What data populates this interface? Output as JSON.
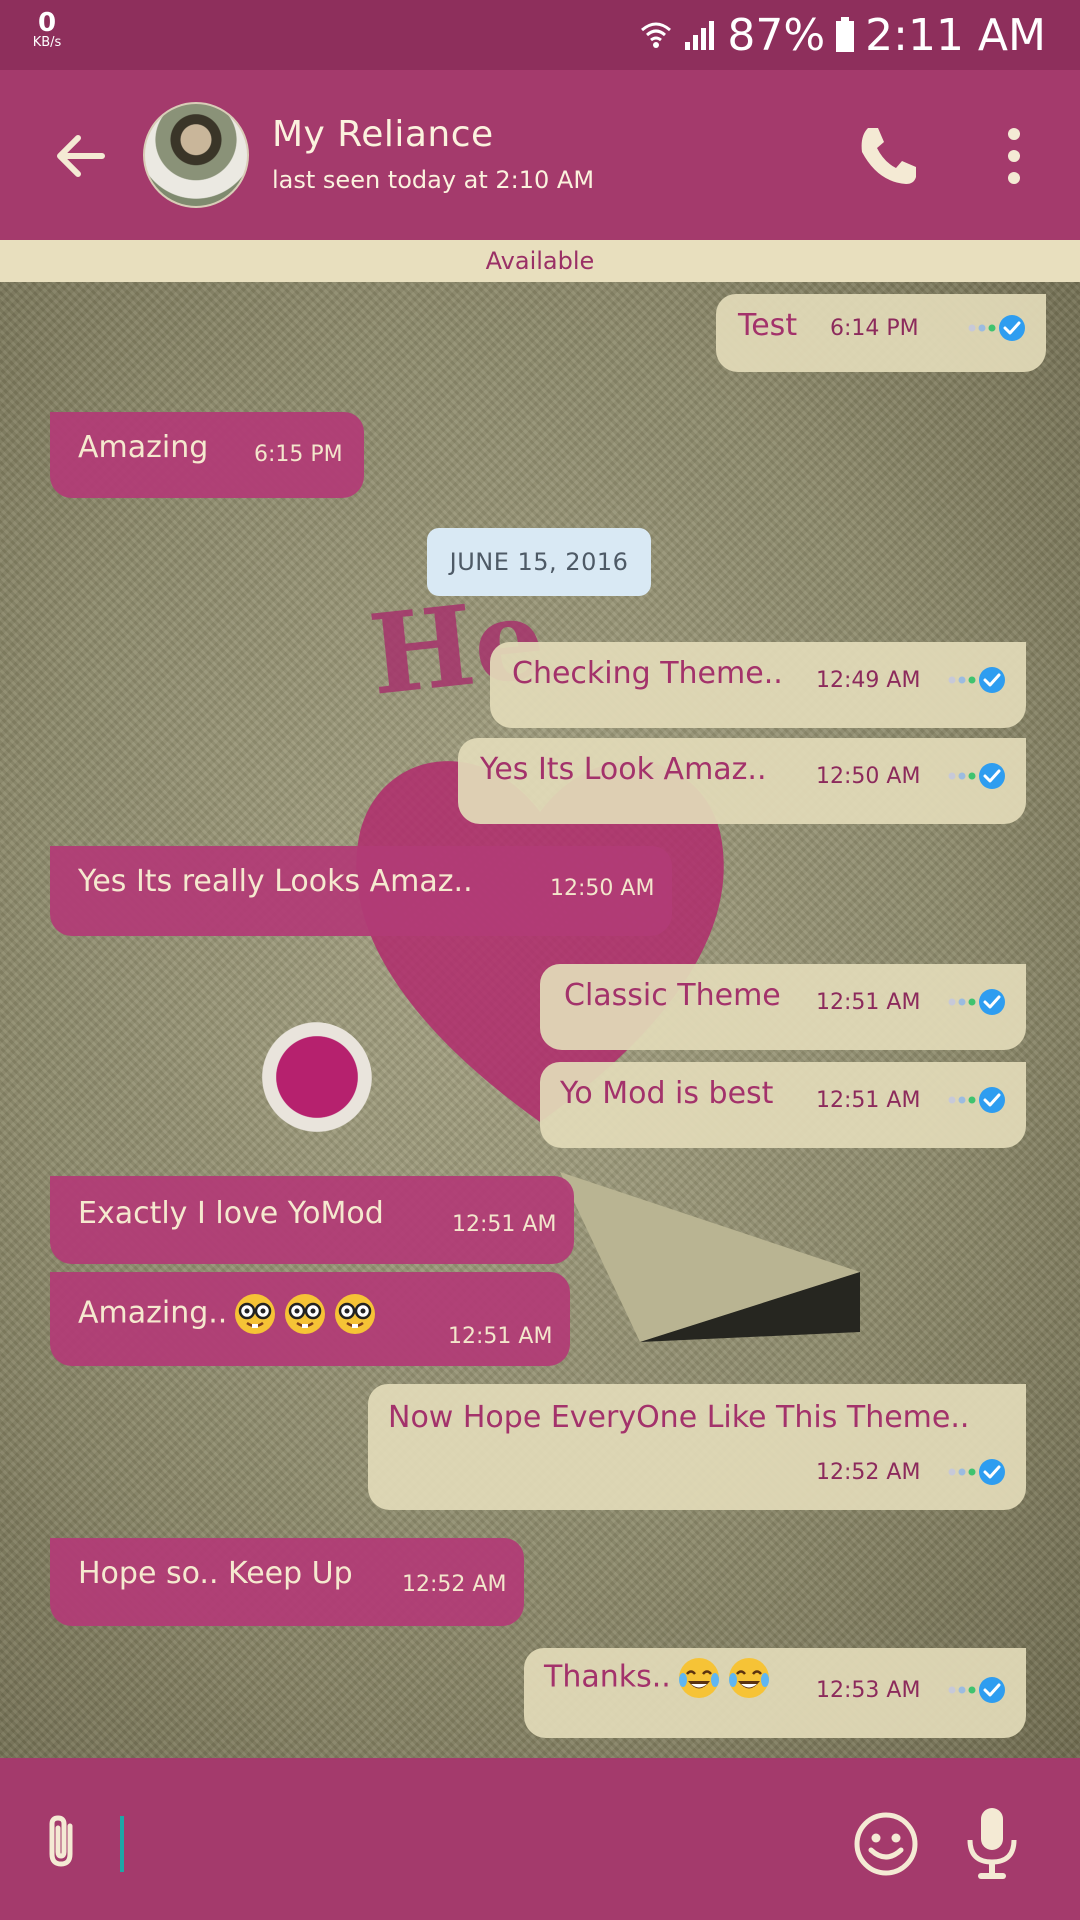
{
  "status_bar": {
    "net_speed": "0",
    "net_unit": "KB/s",
    "battery": "87%",
    "time": "2:11 AM"
  },
  "header": {
    "contact_name": "My Reliance",
    "last_seen": "last seen today at 2:10 AM"
  },
  "status_strip": "Available",
  "date_divider": "JUNE 15, 2016",
  "messages": [
    {
      "dir": "out",
      "text": "Test",
      "time": "6:14 PM"
    },
    {
      "dir": "in",
      "text": "Amazing",
      "time": "6:15 PM"
    },
    {
      "dir": "out",
      "text": "Checking Theme..",
      "time": "12:49 AM"
    },
    {
      "dir": "out",
      "text": "Yes Its Look Amaz..",
      "time": "12:50 AM"
    },
    {
      "dir": "in",
      "text": "Yes Its really Looks Amaz..",
      "time": "12:50 AM"
    },
    {
      "dir": "out",
      "text": "Classic Theme",
      "time": "12:51 AM"
    },
    {
      "dir": "out",
      "text": "Yo Mod is best",
      "time": "12:51 AM"
    },
    {
      "dir": "in",
      "text": "Exactly I love YoMod",
      "time": "12:51 AM"
    },
    {
      "dir": "in",
      "text": "Amazing..",
      "time": "12:51 AM",
      "emojis": [
        "nerd-face",
        "nerd-face",
        "nerd-face"
      ]
    },
    {
      "dir": "out",
      "text": "Now Hope EveryOne Like This Theme..",
      "time": "12:52 AM"
    },
    {
      "dir": "in",
      "text": "Hope so.. Keep Up",
      "time": "12:52 AM"
    },
    {
      "dir": "out",
      "text": "Thanks..",
      "time": "12:53 AM",
      "emojis": [
        "tears-of-joy",
        "tears-of-joy"
      ]
    }
  ],
  "colors": {
    "status_bar": "#8e2f5c",
    "app_bar": "#a43a6c",
    "incoming_bubble": "#b13c76",
    "outgoing_bubble": "#e2dab8",
    "read_tick": "#2e9df0",
    "text_cream": "#f4ead4"
  },
  "icons": {
    "back": "arrow-left-icon",
    "call": "phone-icon",
    "menu": "more-vertical-icon",
    "attach": "paperclip-icon",
    "emoji": "smiley-icon",
    "mic": "microphone-icon"
  }
}
